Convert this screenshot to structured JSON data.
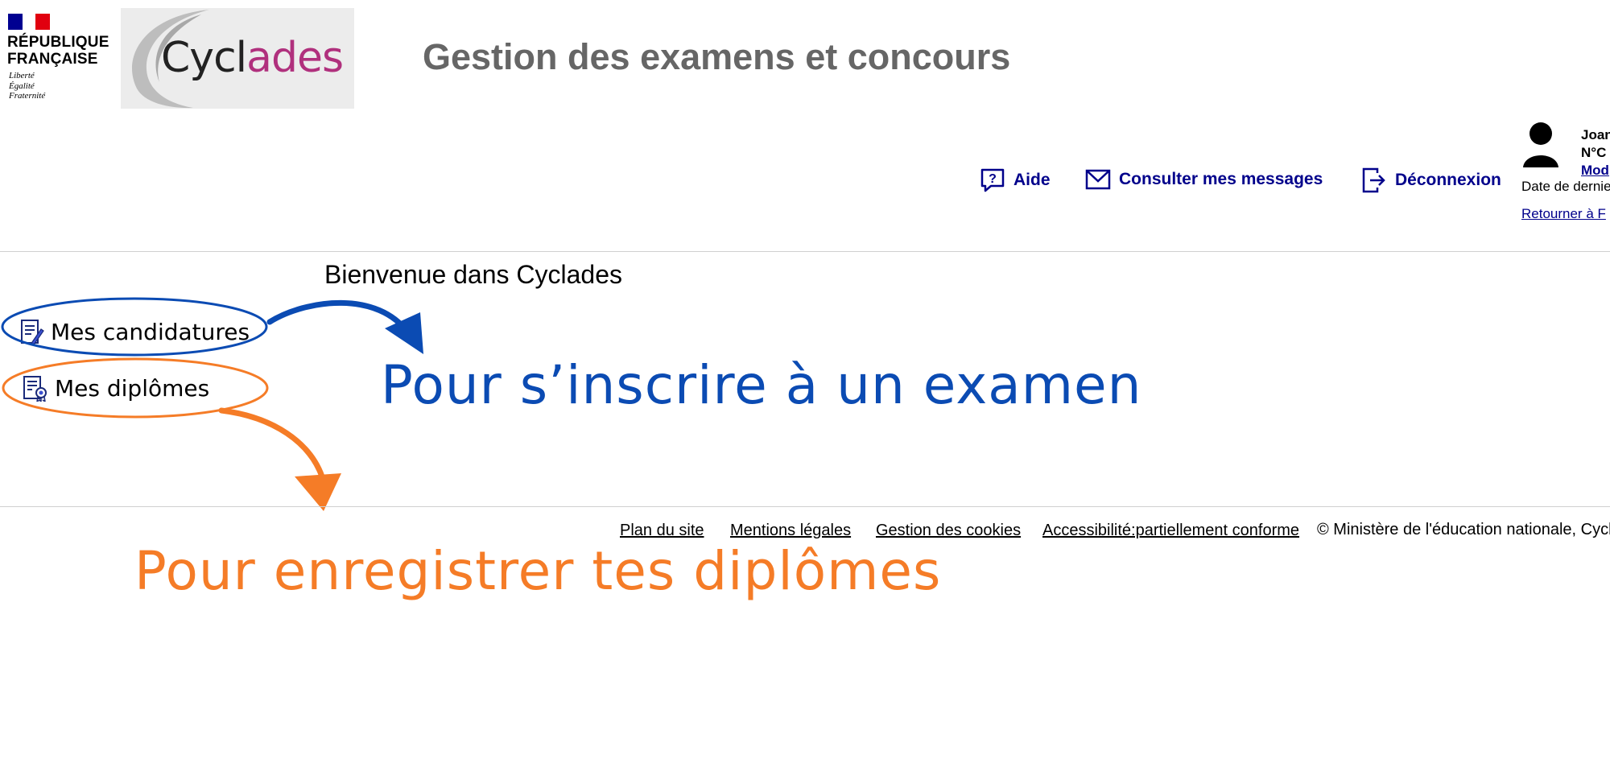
{
  "header": {
    "rf_line1": "RÉPUBLIQUE",
    "rf_line2": "FRANÇAISE",
    "devise_1": "Liberté",
    "devise_2": "Égalité",
    "devise_3": "Fraternité",
    "logo_part1": "Cycl",
    "logo_part2": "ades",
    "app_title": "Gestion des examens et concours"
  },
  "nav": {
    "help": "Aide",
    "messages": "Consulter mes messages",
    "logout": "Déconnexion"
  },
  "user": {
    "name": "Joan",
    "number": "N°C",
    "modify": "Mod",
    "last_login": "Date de dernie",
    "return": "Retourner à F"
  },
  "main": {
    "welcome": "Bienvenue dans Cyclades",
    "menu": [
      {
        "label": "Mes candidatures"
      },
      {
        "label": "Mes diplômes"
      }
    ]
  },
  "annotations": {
    "blue_text": "Pour s’inscrire à un examen",
    "orange_text": "Pour enregistrer tes diplômes",
    "blue_color": "#0b4bb3",
    "orange_color": "#f57c27"
  },
  "footer": {
    "links": [
      "Plan du site",
      "Mentions légales",
      "Gestion des cookies",
      "Accessibilité:partiellement conforme"
    ],
    "copyright": "© Ministère de l'éducation nationale, Cycla"
  },
  "colors": {
    "link_navy": "#00008b",
    "title_grey": "#666666",
    "logo_magenta": "#b0307d"
  }
}
